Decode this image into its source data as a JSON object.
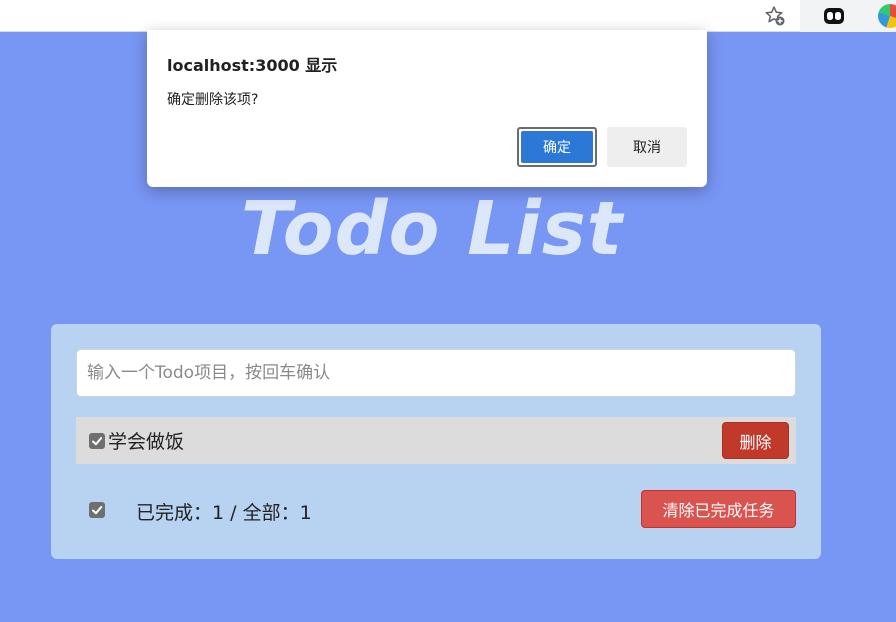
{
  "browser": {
    "icons": [
      "star-add-icon",
      "extension-icon",
      "extension-icon-2"
    ]
  },
  "dialog": {
    "title": "localhost:3000 显示",
    "message": "确定删除该项?",
    "ok_label": "确定",
    "cancel_label": "取消",
    "ok_color": "#2b78d7"
  },
  "app": {
    "title": "Todo List",
    "input_placeholder": "输入一个Todo项目，按回车确认",
    "input_value": "",
    "todos": [
      {
        "text": "学会做饭",
        "done": true,
        "delete_label": "删除"
      }
    ],
    "footer": {
      "all_checked": true,
      "count_text": "已完成：1 / 全部：1",
      "clear_label": "清除已完成任务"
    }
  },
  "colors": {
    "background": "#7896f4",
    "panel": "#b7d3f1",
    "delete": "#c0392b",
    "clear": "#d9534f"
  }
}
